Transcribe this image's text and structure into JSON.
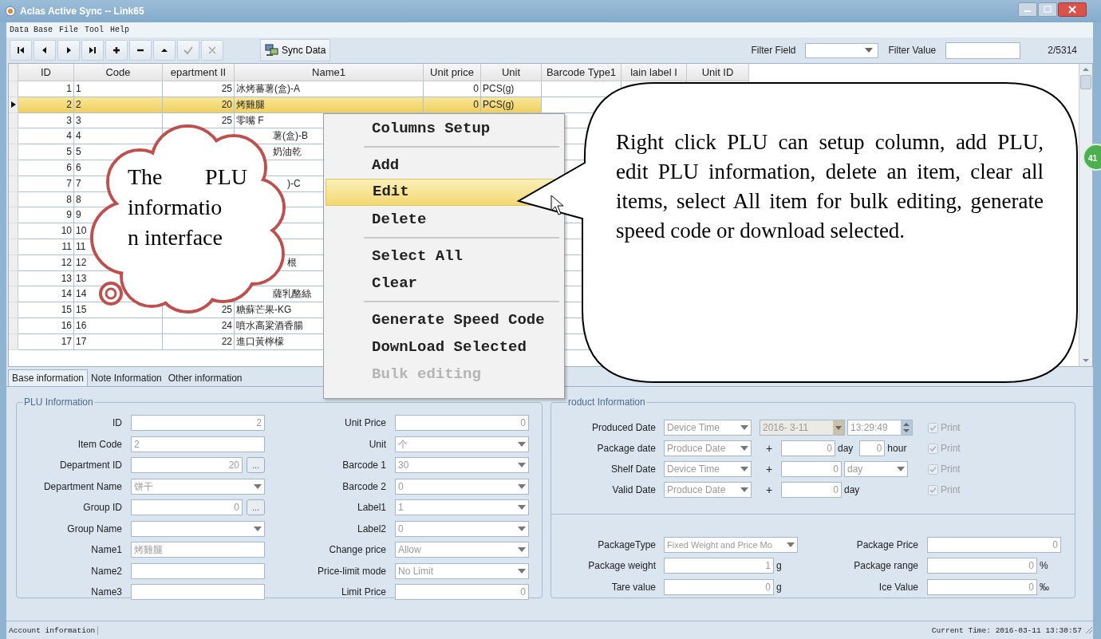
{
  "window": {
    "title": "Aclas Active Sync -- Link65"
  },
  "menu": [
    "Data Base",
    "File",
    "Tool",
    "Help"
  ],
  "toolbar": {
    "buttons": [
      {
        "kind": "first",
        "disabled": false
      },
      {
        "kind": "prev",
        "disabled": false
      },
      {
        "kind": "next",
        "disabled": false
      },
      {
        "kind": "last",
        "disabled": false
      },
      {
        "kind": "add",
        "disabled": false
      },
      {
        "kind": "remove",
        "disabled": false
      },
      {
        "kind": "up",
        "disabled": false
      },
      {
        "kind": "post",
        "disabled": true
      },
      {
        "kind": "cancel",
        "disabled": true
      }
    ],
    "sync": "Sync Data",
    "filter_field_label": "Filter Field",
    "filter_value_label": "Filter Value",
    "record_count": "2/5314"
  },
  "table": {
    "columns": [
      "ID",
      "Code",
      "epartment II",
      "Name1",
      "Unit price",
      "Unit",
      "Barcode Type1",
      "lain label I",
      "Unit ID"
    ],
    "rows": [
      {
        "id": "1",
        "code": "1",
        "dept": "25",
        "name": "冰烤蕃薯(盒)-A",
        "price": "0",
        "unit": "PCS(g)",
        "selected": false
      },
      {
        "id": "2",
        "code": "2",
        "dept": "20",
        "name": "烤雞腿",
        "price": "0",
        "unit": "PCS(g)",
        "selected": true
      },
      {
        "id": "3",
        "code": "3",
        "dept": "25",
        "name": "零嘴 F",
        "selected": false
      },
      {
        "id": "4",
        "code": "4",
        "name": "薯(盒)-B",
        "kind": "partial",
        "selected": false
      },
      {
        "id": "5",
        "code": "5",
        "name": "奶油乾",
        "kind": "partial",
        "selected": false
      },
      {
        "id": "6",
        "code": "6",
        "selected": false
      },
      {
        "id": "7",
        "code": "7",
        "name": ")-C",
        "kind": "partial_far",
        "selected": false
      },
      {
        "id": "8",
        "code": "8",
        "selected": false
      },
      {
        "id": "9",
        "code": "9",
        "selected": false
      },
      {
        "id": "10",
        "code": "10",
        "selected": false
      },
      {
        "id": "11",
        "code": "11",
        "selected": false
      },
      {
        "id": "12",
        "code": "12",
        "name": "根",
        "kind": "partial_far",
        "selected": false
      },
      {
        "id": "13",
        "code": "13",
        "selected": false
      },
      {
        "id": "14",
        "code": "14",
        "name": "薩乳酪絲",
        "kind": "partial",
        "selected": false
      },
      {
        "id": "15",
        "code": "15",
        "dept": "25",
        "name": "糖蘇芒果-KG",
        "selected": false
      },
      {
        "id": "16",
        "code": "16",
        "dept": "24",
        "name": "噴水高粱酒香腸",
        "selected": false
      },
      {
        "id": "17",
        "code": "17",
        "dept": "22",
        "name": "進口黃檸檬",
        "selected": false
      }
    ]
  },
  "context_menu": [
    {
      "kind": "item",
      "label": "Columns Setup",
      "selected": false,
      "disabled": false
    },
    {
      "kind": "separator"
    },
    {
      "kind": "item",
      "label": "Add",
      "selected": false,
      "disabled": false
    },
    {
      "kind": "item",
      "label": "Edit",
      "selected": true,
      "disabled": false
    },
    {
      "kind": "item",
      "label": "Delete",
      "selected": false,
      "disabled": false
    },
    {
      "kind": "separator"
    },
    {
      "kind": "item",
      "label": "Select All",
      "selected": false,
      "disabled": false
    },
    {
      "kind": "item",
      "label": "Clear",
      "selected": false,
      "disabled": false
    },
    {
      "kind": "separator"
    },
    {
      "kind": "item",
      "label": "Generate Speed Code",
      "selected": false,
      "disabled": false
    },
    {
      "kind": "item",
      "label": "DownLoad Selected",
      "selected": false,
      "disabled": false
    },
    {
      "kind": "item",
      "label": "Bulk editing",
      "selected": false,
      "disabled": true
    }
  ],
  "callouts": {
    "cloud": [
      "The PLU",
      "informatio",
      "n interface"
    ],
    "bubble": "Right click PLU can setup column, add PLU, edit PLU information, delete an item, clear all items, select All item for bulk editing, generate speed code or download selected."
  },
  "side_badge": "41",
  "tabs": [
    {
      "label": "Base information",
      "selected": true
    },
    {
      "label": "Note Information",
      "selected": false
    },
    {
      "label": "Other information",
      "selected": false
    }
  ],
  "plu_info": {
    "title": "PLU Information",
    "left": [
      {
        "label": "ID",
        "value": "2",
        "kind": "number"
      },
      {
        "label": "Item Code",
        "value": "2",
        "kind": "text"
      },
      {
        "label": "Department ID",
        "value": "20",
        "kind": "lookup",
        "button": "..."
      },
      {
        "label": "Department Name",
        "value": "饼干",
        "kind": "select"
      },
      {
        "label": "Group ID",
        "value": "0",
        "kind": "lookup",
        "button": "..."
      },
      {
        "label": "Group Name",
        "kind": "select"
      },
      {
        "label": "Name1",
        "value": "烤雞腿",
        "kind": "text"
      },
      {
        "label": "Name2",
        "kind": "text"
      },
      {
        "label": "Name3",
        "kind": "text"
      }
    ],
    "right": [
      {
        "label": "Unit Price",
        "value": "0",
        "kind": "number"
      },
      {
        "label": "Unit",
        "value": "个",
        "kind": "select"
      },
      {
        "label": "Barcode 1",
        "value": "30",
        "kind": "select"
      },
      {
        "label": "Barcode 2",
        "value": "0",
        "kind": "select"
      },
      {
        "label": "Label1",
        "value": "1",
        "kind": "select"
      },
      {
        "label": "Label2",
        "value": "0",
        "kind": "select"
      },
      {
        "label": "Change price",
        "value": "Allow",
        "kind": "select"
      },
      {
        "label": "Price-limit mode",
        "value": "No Limit",
        "kind": "select"
      },
      {
        "label": "Limit Price",
        "value": "0",
        "kind": "number"
      }
    ]
  },
  "product_info": {
    "title": "roduct Information",
    "dates": [
      {
        "label": "Produced Date",
        "source": "Device Time",
        "parts": [
          {
            "kind": "date",
            "value": "2016-  3-11"
          },
          {
            "kind": "time",
            "value": "13:29:49"
          }
        ],
        "print": {
          "label": "Print",
          "checked": true,
          "disabled": true
        }
      },
      {
        "label": "Package date",
        "source": "Produce Date",
        "plus": "+",
        "parts": [
          {
            "kind": "short",
            "value": "0",
            "unit": "day"
          },
          {
            "kind": "tiny",
            "value": "0",
            "unit": "hour"
          }
        ],
        "print": {
          "label": "Print",
          "checked": true,
          "disabled": true
        }
      },
      {
        "label": "Shelf Date",
        "source": "Device Time",
        "plus": "+",
        "parts": [
          {
            "kind": "num",
            "value": "0"
          },
          {
            "kind": "select",
            "value": "day"
          }
        ],
        "print": {
          "label": "Print",
          "checked": true,
          "disabled": true
        }
      },
      {
        "label": "Valid Date",
        "source": "Produce Date",
        "plus": "+",
        "parts": [
          {
            "kind": "num",
            "value": "0",
            "unit": "day"
          }
        ],
        "print": {
          "label": "Print",
          "checked": true,
          "disabled": true
        }
      }
    ],
    "package": [
      {
        "left": {
          "label": "PackageType",
          "value": "Fixed Weight and Price Mo",
          "kind": "select"
        },
        "right": {
          "label": "Package Price",
          "value": "0",
          "kind": "number"
        }
      },
      {
        "left": {
          "label": "Package weight",
          "value": "1",
          "kind": "number",
          "unit": "g"
        },
        "right": {
          "label": "Package range",
          "value": "0",
          "kind": "number",
          "unit": "%"
        }
      },
      {
        "left": {
          "label": "Tare value",
          "value": "0",
          "kind": "number",
          "unit": "g"
        },
        "right": {
          "label": "Ice Value",
          "value": "0",
          "kind": "number",
          "unit": "‰"
        }
      }
    ]
  },
  "status_bar": {
    "left": "Account information",
    "right": "Current Time: 2016-03-11 13:30:57"
  }
}
